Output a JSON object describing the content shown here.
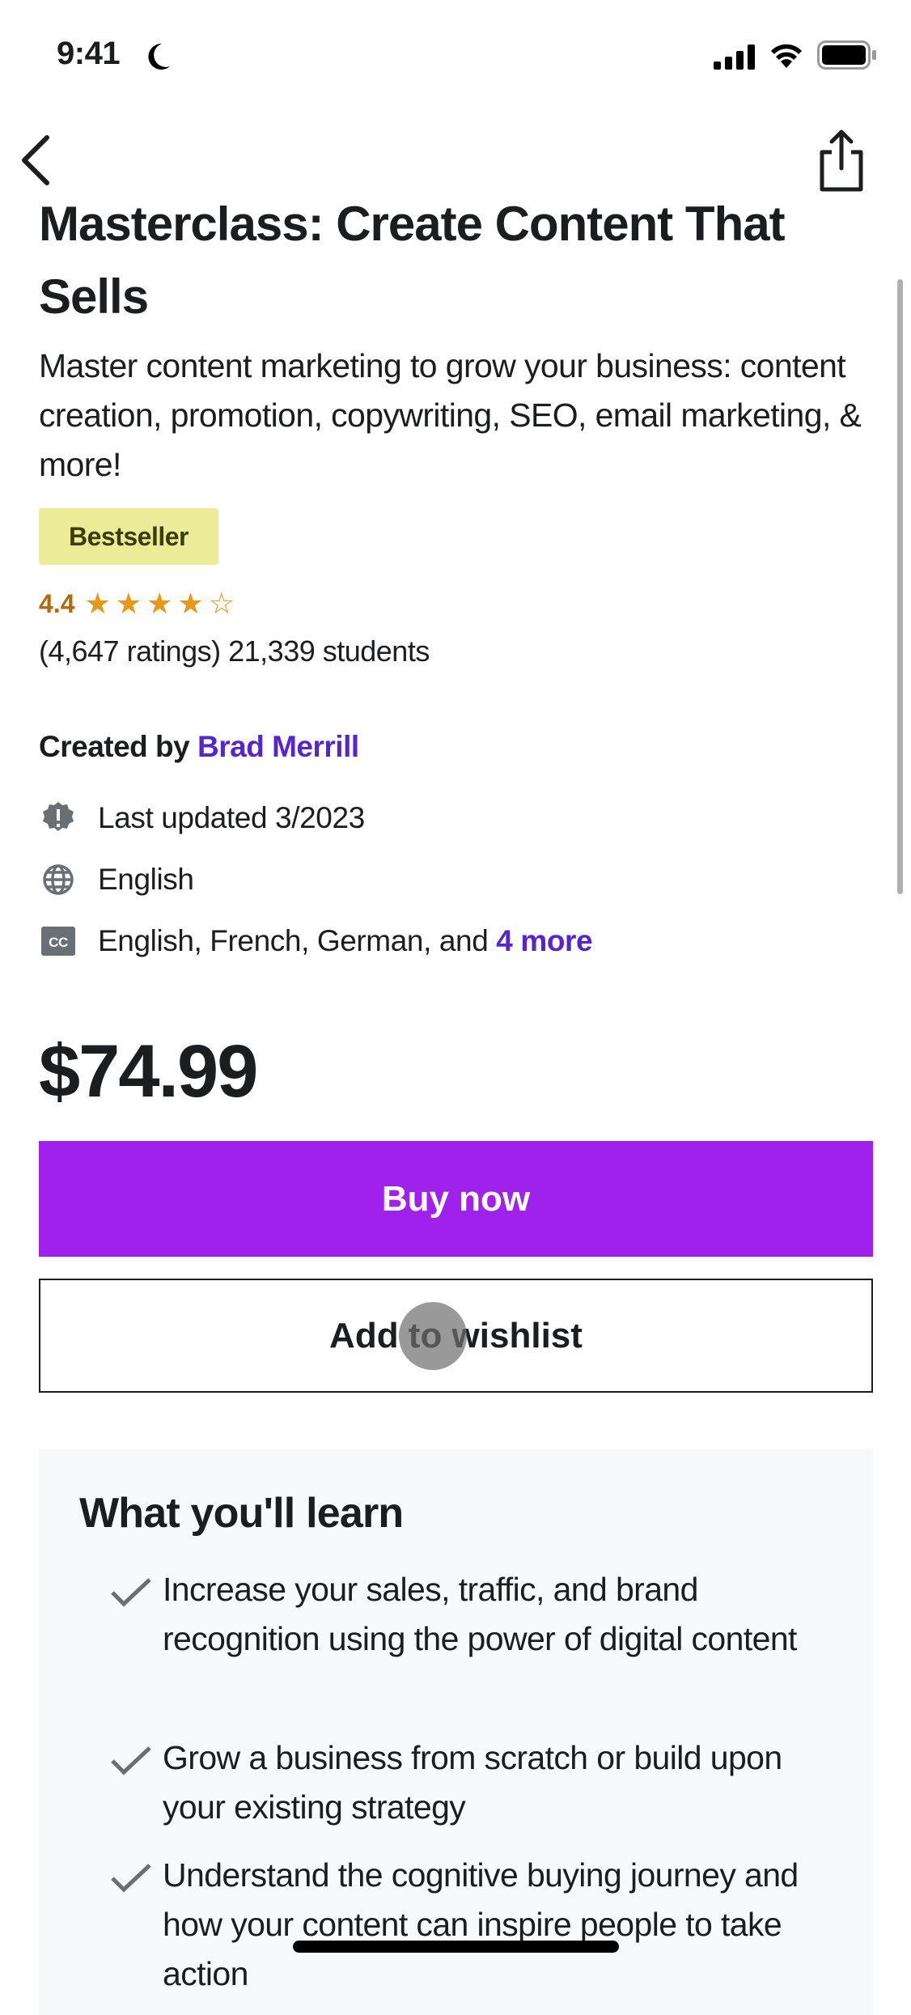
{
  "status_bar": {
    "time": "9:41",
    "icons": [
      "moon-icon",
      "signal-icon",
      "wifi-icon",
      "battery-icon"
    ]
  },
  "nav": {
    "back_icon": "chevron-left-icon",
    "share_icon": "share-icon"
  },
  "course": {
    "title": "Masterclass: Create Content That Sells",
    "subtitle": "Master content marketing to grow your business: content creation, promotion, copywriting, SEO, email marketing, & more!",
    "badge": "Bestseller",
    "rating": "4.4",
    "rating_value": 4.4,
    "counts": "(4,647 ratings) 21,339 students",
    "created_by_label": "Created by",
    "instructor": "Brad Merrill",
    "last_updated": "Last updated 3/2023",
    "language": "English",
    "captions": "English, French, German, and",
    "captions_more": "4 more",
    "price": "$74.99"
  },
  "actions": {
    "buy": "Buy now",
    "wishlist": "Add to wishlist"
  },
  "learn": {
    "title": "What you'll learn",
    "items": [
      "Increase your sales, traffic, and brand recognition using the power of digital content",
      "Grow a business from scratch or build upon your existing strategy",
      "Understand the cognitive buying journey and how your content can inspire people to take action"
    ]
  },
  "colors": {
    "accent": "#a020ec",
    "link": "#5624d0",
    "rating": "#b4690e",
    "badge": "#eceb98"
  }
}
